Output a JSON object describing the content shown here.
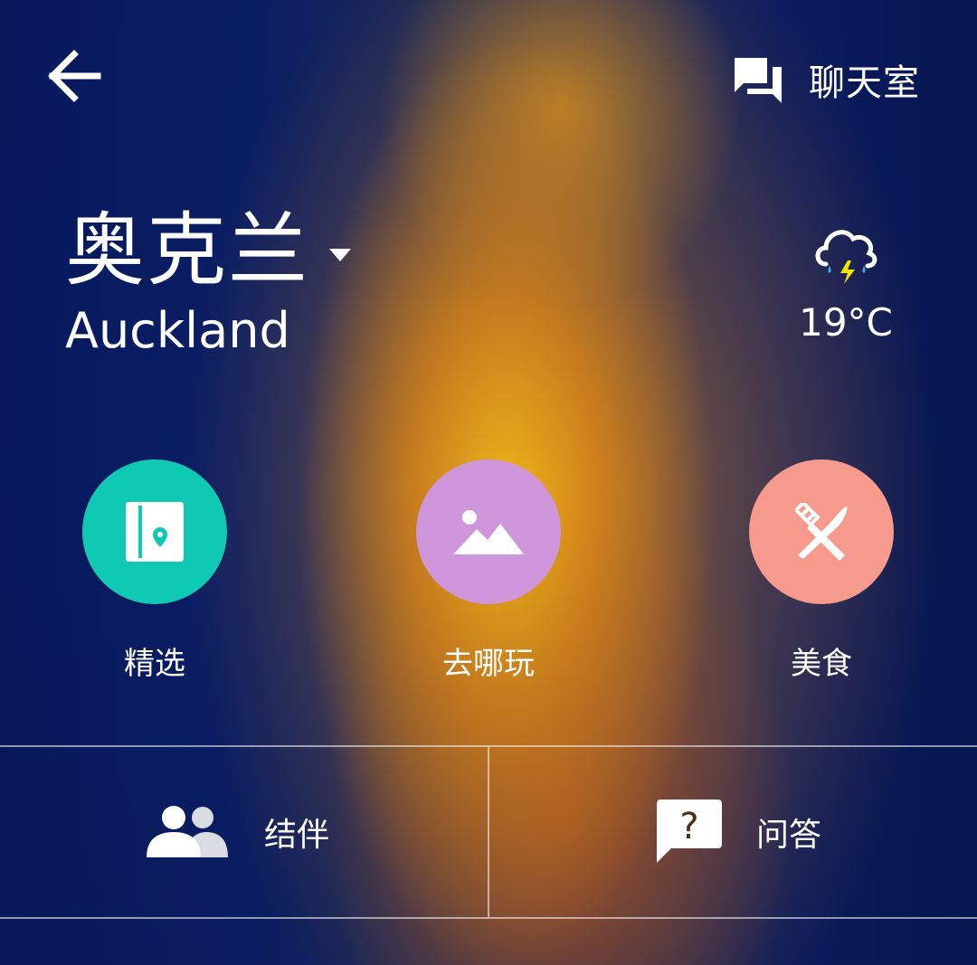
{
  "header": {
    "back_icon": "arrow-left-icon",
    "chat_icon": "chat-bubbles-icon",
    "chat_label": "聊天室"
  },
  "city": {
    "name_cn": "奥克兰",
    "name_en": "Auckland",
    "dropdown_icon": "caret-down-icon"
  },
  "weather": {
    "icon": "thunderstorm-rain-icon",
    "temperature": "19°C"
  },
  "categories": [
    {
      "label": "精选",
      "icon": "guidebook-location-icon",
      "color": "#10c9b5"
    },
    {
      "label": "去哪玩",
      "icon": "landscape-icon",
      "color": "#cf96dc"
    },
    {
      "label": "美食",
      "icon": "fork-knife-icon",
      "color": "#f59a8c"
    }
  ],
  "bottom": {
    "companion_label": "结伴",
    "companion_icon": "people-icon",
    "qa_label": "问答",
    "qa_icon": "question-bubble-icon"
  }
}
